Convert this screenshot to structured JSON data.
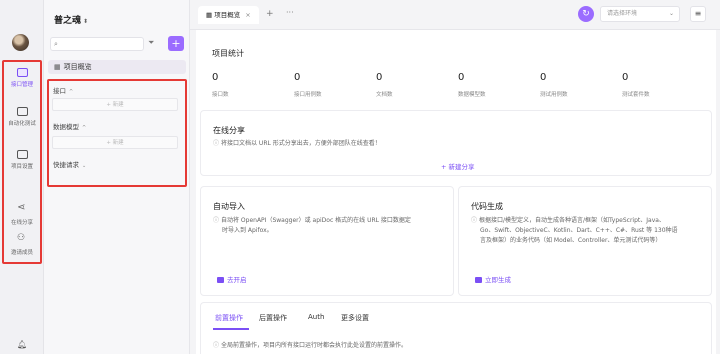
{
  "project": {
    "name": "普之魂"
  },
  "rail": {
    "items": [
      {
        "label": "接口管理",
        "active": true
      },
      {
        "label": "自动化测试",
        "active": false
      },
      {
        "label": "项目设置",
        "active": false
      },
      {
        "label": "在线分享",
        "active": false
      },
      {
        "label": "邀请成员",
        "active": false
      }
    ]
  },
  "sidebar": {
    "overview_label": "项目概览",
    "sections": [
      {
        "title": "接口",
        "new_label": "+ 新建"
      },
      {
        "title": "数据模型",
        "new_label": "+ 新建"
      },
      {
        "title": "快捷请求"
      }
    ]
  },
  "tabbar": {
    "active_tab": "项目概览",
    "env_placeholder": "请选择环境"
  },
  "stats": {
    "title": "项目统计",
    "items": [
      {
        "value": "0",
        "label": "接口数"
      },
      {
        "value": "0",
        "label": "接口用例数"
      },
      {
        "value": "0",
        "label": "文档数"
      },
      {
        "value": "0",
        "label": "数据模型数"
      },
      {
        "value": "0",
        "label": "测试用例数"
      },
      {
        "value": "0",
        "label": "测试套件数"
      }
    ]
  },
  "share": {
    "title": "在线分享",
    "desc": "将接口文档以 URL 形式分享出去，方便外部团队在线查看！",
    "button": "+ 新建分享"
  },
  "import": {
    "title": "自动导入",
    "desc_1": "自动将 OpenAPI（Swagger）或 apiDoc 格式的在线 URL 接口数据定",
    "desc_2": "时导入到 Apifox。",
    "action": "去开启"
  },
  "codegen": {
    "title": "代码生成",
    "desc_1": "根据接口/模型定义，自动生成各种语言/框架（如TypeScript、Java、",
    "desc_2": "Go、Swift、ObjectiveC、Kotlin、Dart、C++、C#、Rust 等 130种语",
    "desc_3": "言及框架）的业务代码（如 Model、Controller、单元测试代码等）",
    "action": "立即生成"
  },
  "bottom_tabs": [
    "前置操作",
    "后置操作",
    "Auth",
    "更多设置"
  ],
  "bottom_info": "全局前置操作，项目内所有接口运行时都会执行此处设置的前置操作。",
  "colors": {
    "accent": "#7b4ff5",
    "highlight_box": "#e53935"
  }
}
